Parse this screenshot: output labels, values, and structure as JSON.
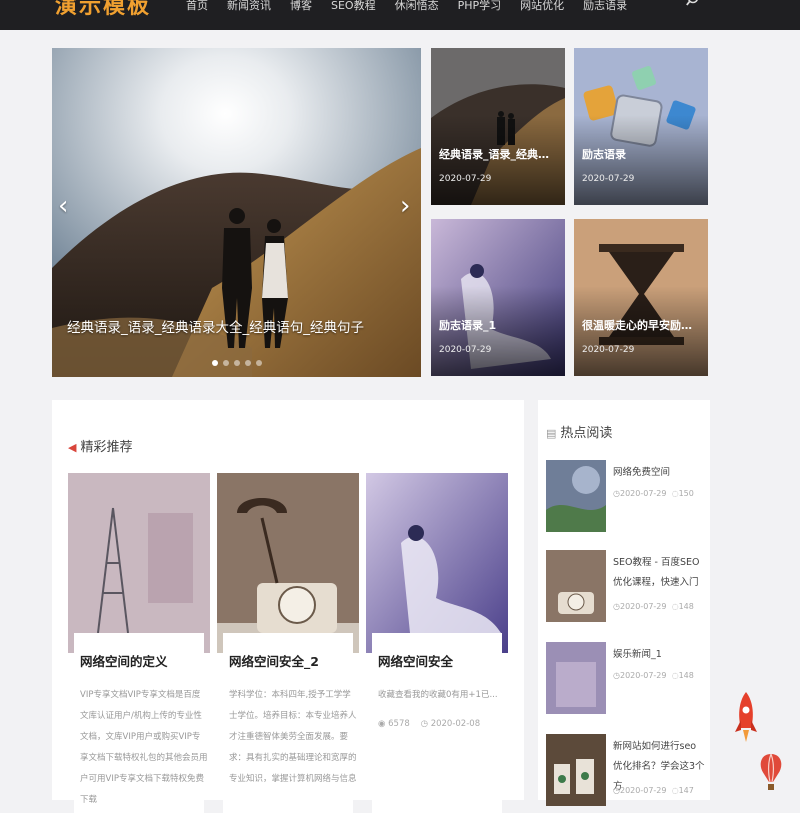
{
  "brand": {
    "logo": "演示模板"
  },
  "nav": [
    "首页",
    "新闻资讯",
    "博客",
    "SEO教程",
    "休闲悟态",
    "PHP学习",
    "网站优化",
    "励志语录"
  ],
  "slider": {
    "caption": "经典语录_语录_经典语录大全_经典语句_经典句子",
    "prev_arrow": "‹",
    "next_arrow": "›",
    "dot_count": 5
  },
  "tiles": [
    {
      "title": "经典语录_语录_经典语录大全_经典语句",
      "date": "2020-07-29"
    },
    {
      "title": "励志语录",
      "date": "2020-07-29"
    },
    {
      "title": "励志语录_1",
      "date": "2020-07-29"
    },
    {
      "title": "很温暖走心的早安励志语录",
      "date": "2020-07-29"
    }
  ],
  "featured": {
    "heading": "精彩推荐",
    "cards": [
      {
        "title": "网络空间的定义",
        "text": "VIP专享文档VIP专享文档是百度文库认证用户/机构上传的专业性文档，文库VIP用户或购买VIP专享文档下载特权礼包的其他会员用户可用VIP专享文档下载特权免费下载"
      },
      {
        "title": "网络空间安全_2",
        "text": "学科学位：本科四年,授予工学学士学位。培养目标：本专业培养人才注重德智体美劳全面发展。要求：具有扎实的基础理论和宽厚的专业知识，掌握计算机网络与信息"
      },
      {
        "title": "网络空间安全",
        "text": "收藏查看我的收藏0有用+1已...",
        "views": "6578",
        "date": "2020-02-08"
      }
    ]
  },
  "hot": {
    "heading": "热点阅读",
    "items": [
      {
        "title": "网络免费空间",
        "date": "2020-07-29",
        "views": "150"
      },
      {
        "title": "SEO教程 - 百度SEO优化课程，快速入门",
        "date": "2020-07-29",
        "views": "148"
      },
      {
        "title": "娱乐新闻_1",
        "date": "2020-07-29",
        "views": "148"
      },
      {
        "title": "新网站如何进行seo优化排名？学会这3个方",
        "date": "2020-07-29",
        "views": "147"
      }
    ]
  },
  "colors": {
    "topbar": "#1f1f22",
    "logo": "#f0a030",
    "accent_red": "#d9453b",
    "page_bg": "#f2f2f4"
  },
  "icons": [
    "search-icon",
    "megaphone-icon",
    "document-icon",
    "clock-icon",
    "comment-icon",
    "eye-icon",
    "rocket-icon",
    "balloon-icon"
  ]
}
